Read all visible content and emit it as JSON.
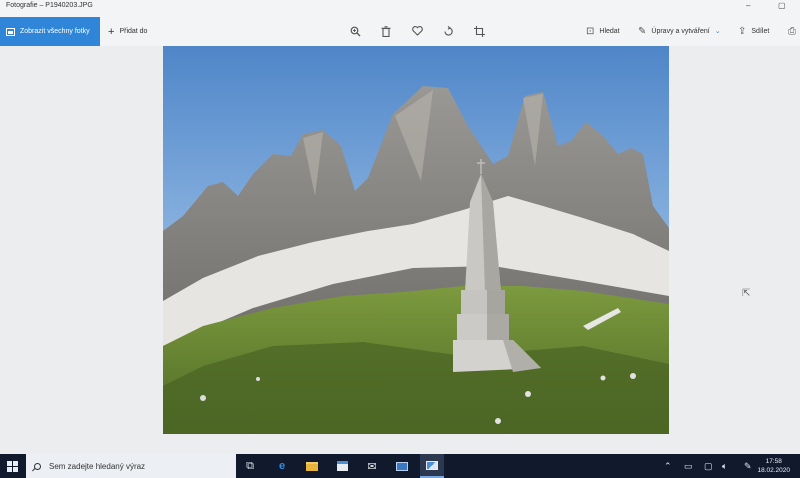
{
  "window": {
    "title": "Fotografie – P1940203.JPG",
    "controls": [
      "–",
      "▢"
    ]
  },
  "toolbar": {
    "view_all_label": "Zobrazit všechny fotky",
    "add_label": "Přidat do",
    "find_label": "Hledat",
    "edit_label": "Úpravy a vytváření",
    "share_label": "Sdílet",
    "accent_color": "#2f86d9"
  },
  "taskbar": {
    "search_placeholder": "Sem zadejte hledaný výraz",
    "time": "17:58",
    "date": "18.02.2020",
    "apps": [
      "task-view",
      "edge",
      "file-explorer",
      "store",
      "mail",
      "remote-desktop",
      "photos"
    ]
  }
}
